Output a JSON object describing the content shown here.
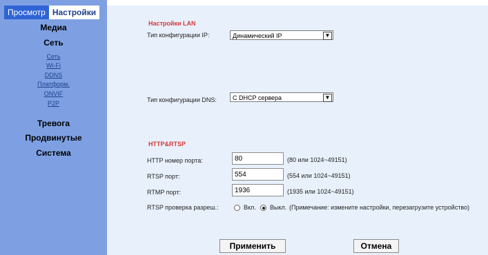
{
  "tabs": {
    "view": "Просмотр",
    "settings": "Настройки"
  },
  "menu": {
    "media": "Медиа",
    "network": "Сеть",
    "network_items": [
      "Сеть",
      "Wi-Fi",
      "DDNS",
      "Платформ.",
      "ONVIF",
      "P2P"
    ],
    "alarm": "Тревога",
    "advanced": "Продвинутые",
    "system": "Система"
  },
  "lan": {
    "title": "Настройки LAN",
    "ip_type_label": "Тип конфигурации IP:",
    "ip_type_value": "Динамический IP",
    "dns_type_label": "Тип конфигурации DNS:",
    "dns_type_value": "С DHCP сервера"
  },
  "http": {
    "title": "HTTP&RTSP",
    "http_port_label": "HTTP номер порта:",
    "http_port_value": "80",
    "http_port_hint": "(80 или 1024~49151)",
    "rtsp_port_label": "RTSP порт:",
    "rtsp_port_value": "554",
    "rtsp_port_hint": "(554 или 1024~49151)",
    "rtmp_port_label": "RTMP порт:",
    "rtmp_port_value": "1936",
    "rtmp_port_hint": "(1935 или 1024~49151)",
    "rtsp_auth_label": "RTSP проверка разреш.:",
    "rtsp_auth_on": "Вкл.",
    "rtsp_auth_off": "Выкл.",
    "rtsp_auth_selected": "off",
    "rtsp_auth_note": "(Примечание: измените настройки, перезагрузите устройство)"
  },
  "buttons": {
    "apply": "Применить",
    "cancel": "Отмена"
  },
  "colors": {
    "sidebar": "#7ea0e3",
    "tab_inactive": "#2f64d4",
    "content": "#e8f0fb",
    "section_title": "#d23a3a"
  }
}
